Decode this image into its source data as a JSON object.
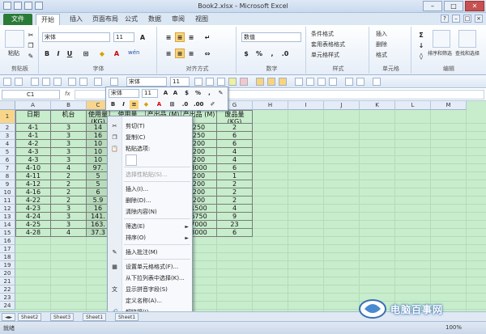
{
  "window": {
    "title": "Book2.xlsx - Microsoft Excel",
    "controls": [
      "–",
      "□",
      "✕"
    ]
  },
  "tabs": {
    "file": "文件",
    "items": [
      "开始",
      "插入",
      "页面布局",
      "公式",
      "数据",
      "审阅",
      "视图"
    ],
    "active": "开始"
  },
  "ribbon": {
    "clipboard": {
      "paste": "粘贴",
      "label": "剪贴板"
    },
    "font": {
      "name": "宋体",
      "size": "11",
      "label": "字体",
      "phonetic": "wén"
    },
    "alignment": {
      "label": "对齐方式"
    },
    "number": {
      "format": "数值",
      "label": "数字"
    },
    "styles": {
      "cond": "条件格式",
      "table": "套用表格格式",
      "cell": "单元格样式",
      "label": "样式"
    },
    "cells": {
      "insert": "插入",
      "delete": "删除",
      "format": "格式",
      "label": "单元格"
    },
    "editing": {
      "sort": "排序和筛选",
      "find": "查找和选择",
      "label": "编辑"
    }
  },
  "toolbar2": {
    "font": "宋体",
    "size": "11"
  },
  "formula": {
    "namebox": "C1",
    "fx": "fx",
    "value": ""
  },
  "grid": {
    "columns": [
      "A",
      "B",
      "C",
      "D",
      "E",
      "F",
      "G",
      "H",
      "I",
      "J",
      "K",
      "L",
      "M"
    ],
    "selected_column": "C",
    "headers": [
      "日期",
      "机台",
      "使用量 (KG)",
      "使用量 (KG)",
      "产出品 (M)",
      "产出品 (M)",
      "废品量 (KG)"
    ],
    "rows": [
      [
        "4-1",
        "3",
        "14",
        "",
        "",
        "250",
        "2"
      ],
      [
        "4-1",
        "3",
        "16",
        "",
        "",
        "250",
        "6"
      ],
      [
        "4-2",
        "3",
        "10",
        "",
        "",
        "200",
        "6"
      ],
      [
        "4-3",
        "3",
        "10",
        "",
        "",
        "200",
        "4"
      ],
      [
        "4-3",
        "3",
        "10",
        "",
        "",
        "200",
        "4"
      ],
      [
        "4-10",
        "4",
        "97.",
        "",
        "",
        "3000",
        "6"
      ],
      [
        "4-11",
        "2",
        "5",
        "",
        "",
        "200",
        "1"
      ],
      [
        "4-12",
        "2",
        "5",
        "",
        "",
        "200",
        "2"
      ],
      [
        "4-16",
        "2",
        "6",
        "",
        "",
        "200",
        "2"
      ],
      [
        "4-22",
        "2",
        "5.9",
        "",
        "",
        "200",
        "2"
      ],
      [
        "4-23",
        "3",
        "16",
        "",
        "",
        "1500",
        "4"
      ],
      [
        "4-24",
        "3",
        "141.",
        "",
        "",
        "6750",
        "9"
      ],
      [
        "4-25",
        "3",
        "163.",
        "",
        "",
        "7000",
        "23"
      ],
      [
        "4-28",
        "4",
        "37.3",
        "",
        "",
        "3000",
        "6"
      ]
    ]
  },
  "mini_toolbar": {
    "font": "宋体",
    "size": "11"
  },
  "context_menu": [
    {
      "label": "剪切(T)",
      "icon": "scissors-icon",
      "disabled": false
    },
    {
      "label": "复制(C)",
      "icon": "copy-icon",
      "disabled": false
    },
    {
      "label": "粘贴选项:",
      "icon": "paste-icon",
      "disabled": false
    },
    {
      "label": "选择性粘贴(S)...",
      "icon": "",
      "disabled": true
    },
    {
      "label": "插入(I)...",
      "icon": "",
      "disabled": false
    },
    {
      "label": "删除(D)...",
      "icon": "",
      "disabled": false
    },
    {
      "label": "清除内容(N)",
      "icon": "",
      "disabled": false
    },
    {
      "label": "筛选(E)",
      "icon": "",
      "disabled": false,
      "submenu": true
    },
    {
      "label": "排序(O)",
      "icon": "",
      "disabled": false,
      "submenu": true
    },
    {
      "label": "插入批注(M)",
      "icon": "comment-icon",
      "disabled": false
    },
    {
      "label": "设置单元格格式(F)...",
      "icon": "format-cells-icon",
      "disabled": false
    },
    {
      "label": "从下拉列表中选择(K)...",
      "icon": "",
      "disabled": false
    },
    {
      "label": "显示拼音字段(S)",
      "icon": "phonetic-icon",
      "disabled": false
    },
    {
      "label": "定义名称(A)...",
      "icon": "",
      "disabled": false
    },
    {
      "label": "超链接(I)...",
      "icon": "hyperlink-icon",
      "disabled": false
    }
  ],
  "sheets": [
    "Sheet2",
    "Sheet3",
    "Sheet1",
    "Sheet1"
  ],
  "status": {
    "ready": "就绪",
    "zoom": "100%"
  },
  "watermark": "电脑百事网"
}
